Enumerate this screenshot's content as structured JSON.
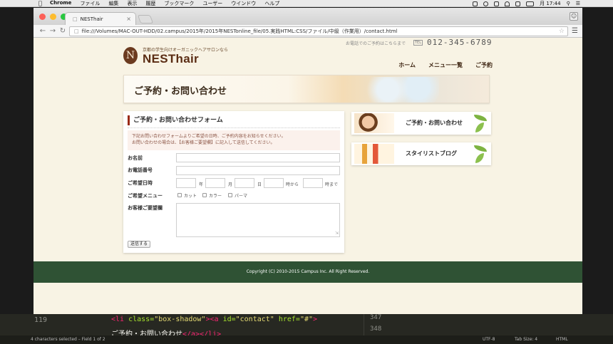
{
  "menubar": {
    "app": "Chrome",
    "items": [
      "ファイル",
      "編集",
      "表示",
      "履歴",
      "ブックマーク",
      "ユーザー",
      "ウインドウ",
      "ヘルプ"
    ],
    "clock": "月 17:44"
  },
  "browser": {
    "tab_title": "NESThair",
    "url": "file:///Volumes/MAC-OUT-HDD/02.campus/2015年/2015年NESTonline_file/05.実践HTML:CSS/ファイル/中級（作業用）/contact.html"
  },
  "site": {
    "tagline": "京都の学生向けオーガニックヘアサロンなら",
    "logo_letter": "N",
    "logo": "NESThair",
    "phone_label": "お電話でのご予約はこちらまで",
    "tel_badge": "TEL",
    "phone": "012-345-6789",
    "nav": [
      "ホーム",
      "メニュー一覧",
      "ご予約"
    ],
    "banner_title": "ご予約・お問い合わせ"
  },
  "form": {
    "heading": "ご予約・お問い合わせフォーム",
    "notice_line1": "下記お問い合わせフォームよりご希望の日時、ご予約内容をお知らせください。",
    "notice_line2": "お問い合わせの場合は、【お客様ご要望欄】に記入して送信してください。",
    "label_name": "お名前",
    "label_phone": "お電話番号",
    "label_date": "ご希望日時",
    "date_units": [
      "年",
      "月",
      "日",
      "時から",
      "時まで"
    ],
    "label_menu": "ご希望メニュー",
    "menu_options": [
      "カット",
      "カラー",
      "パーマ"
    ],
    "label_request": "お客様ご要望欄",
    "submit": "送信する"
  },
  "sidebar": {
    "buttons": [
      {
        "label": "ご予約・お問い合わせ"
      },
      {
        "label": "スタイリストブログ"
      }
    ]
  },
  "footer": {
    "copyright": "Copyright (C) 2010-2015 Campus Inc. All Right Reserved."
  },
  "editor": {
    "line_number": "119",
    "right_line_numbers": [
      "347",
      "348"
    ],
    "status_left": "4 characters selected – Field 1 of 2",
    "encoding": "UTF-8",
    "tab_size": "Tab Size: 4",
    "syntax": "HTML",
    "code": {
      "li_open": "<li",
      "attr_class": "class=",
      "val_class": "\"box-shadow\"",
      "a_open": "><a",
      "attr_id": "id=",
      "val_id": "\"contact\"",
      "attr_href": "href=",
      "val_href": "\"#\"",
      "gt": ">",
      "line2_text": "ご予約・お問い合わせ",
      "line2_close": "</a></li>"
    }
  },
  "colors": {
    "accent_red": "#9a2a16",
    "footer_green": "#2f5234",
    "logo_brown": "#5a2c13"
  }
}
